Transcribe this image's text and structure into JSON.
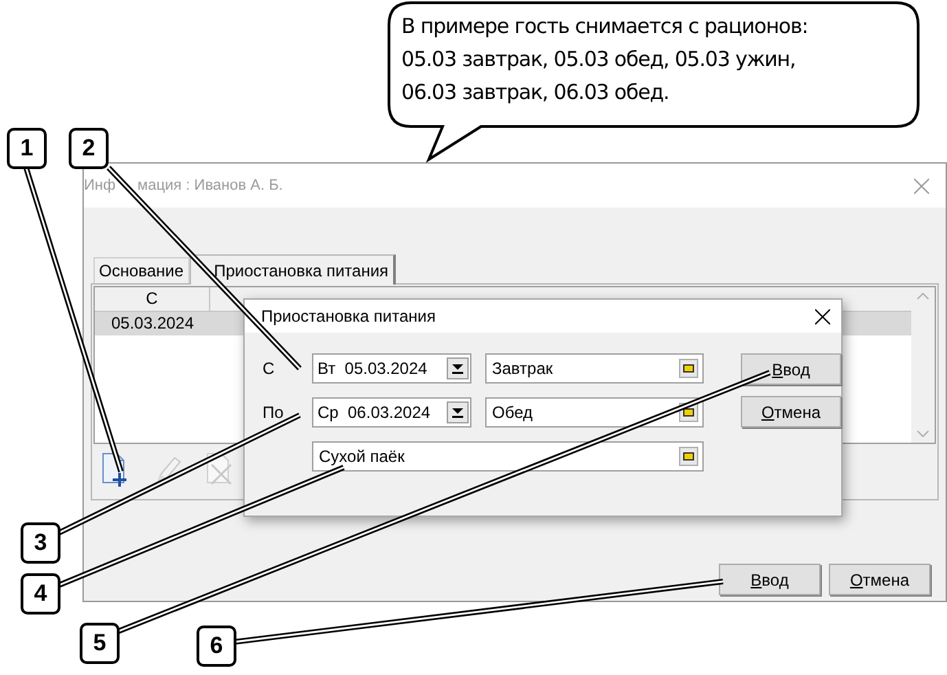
{
  "note_bubble": {
    "lines": [
      "В примере гость снимается с рационов:",
      "05.03 завтрак, 05.03 обед, 05.03 ужин,",
      "06.03 завтрак, 06.03 обед."
    ]
  },
  "callouts": [
    "1",
    "2",
    "3",
    "4",
    "5",
    "6"
  ],
  "window": {
    "title_parts": [
      "Инф",
      "мация : Иванов А. Б."
    ],
    "tabs": [
      {
        "label": "Основание",
        "selected": false
      },
      {
        "label": "Приостановка питания",
        "selected": true
      }
    ],
    "table": {
      "columns": [
        "С"
      ],
      "rows": [
        {
          "cells": [
            "05.03.2024"
          ],
          "selected": true
        }
      ]
    },
    "toolbar": [
      {
        "kind": "add",
        "disabled": false
      },
      {
        "kind": "edit",
        "disabled": true
      },
      {
        "kind": "delete",
        "disabled": true
      }
    ],
    "buttons": [
      {
        "mnemonic": "В",
        "rest": "вод"
      },
      {
        "mnemonic": "О",
        "rest": "тмена"
      }
    ]
  },
  "dialog": {
    "title": "Приостановка питания",
    "rows": [
      {
        "label": "С",
        "weekday": "Вт",
        "date": "05.03.2024",
        "meal": "Завтрак"
      },
      {
        "label": "По",
        "weekday": "Ср",
        "date": "06.03.2024",
        "meal": "Обед"
      }
    ],
    "note": "Сухой паёк",
    "buttons": [
      {
        "mnemonic": "В",
        "rest": "вод"
      },
      {
        "mnemonic": "О",
        "rest": "тмена"
      }
    ]
  }
}
